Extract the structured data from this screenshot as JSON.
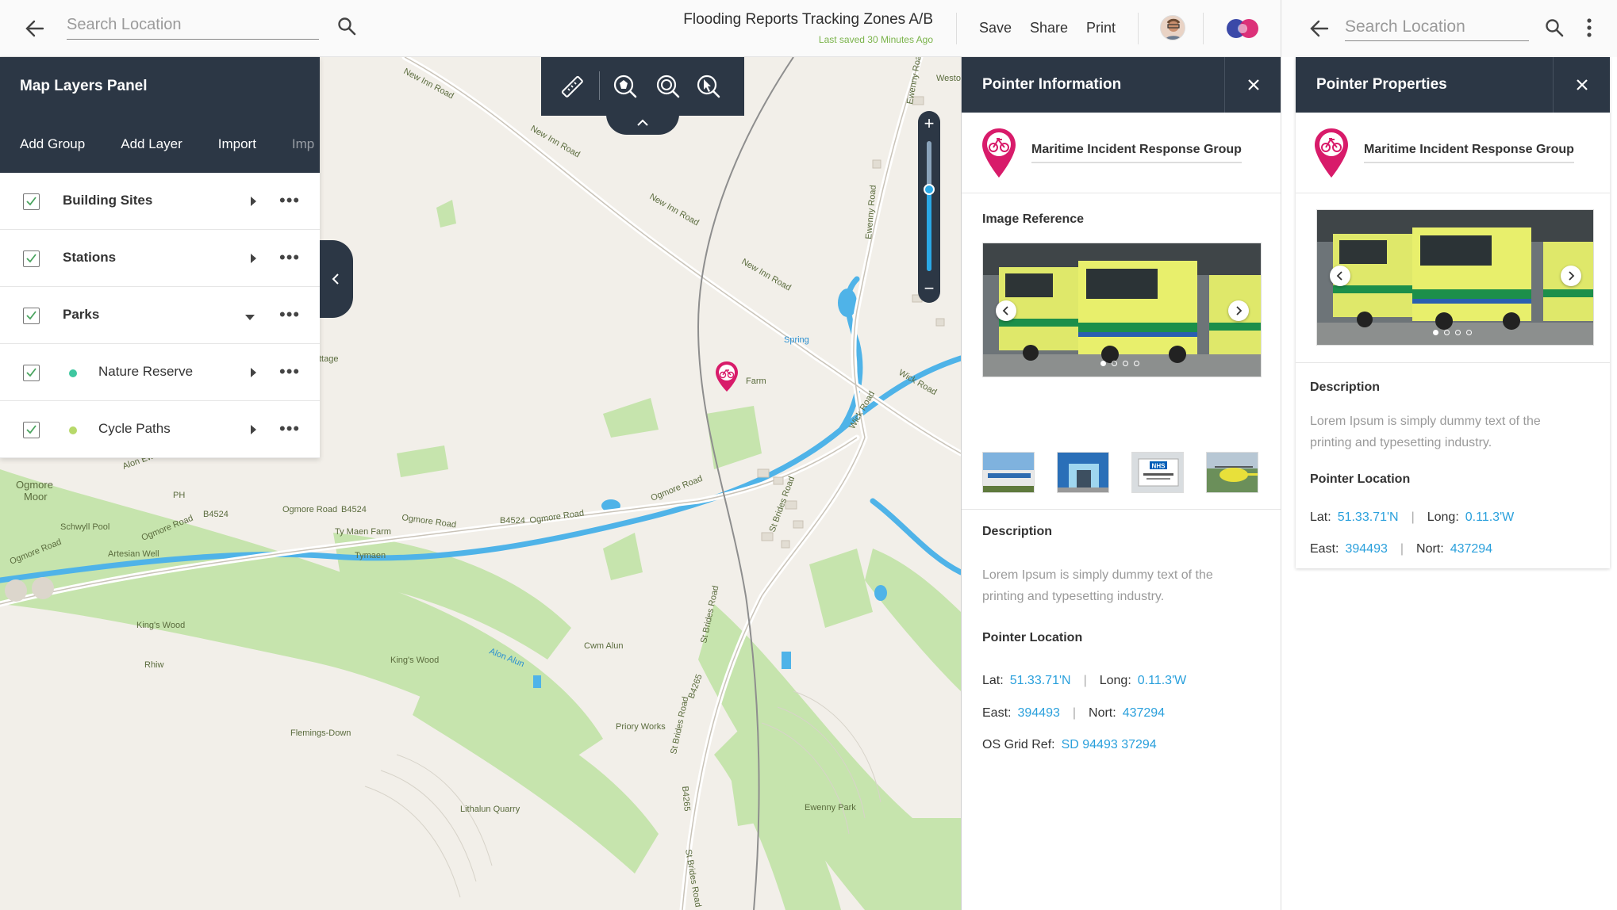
{
  "header": {
    "search_placeholder": "Search Location",
    "title": "Flooding Reports Tracking Zones A/B",
    "last_saved": "Last saved 30 Minutes Ago",
    "actions": [
      "Save",
      "Share",
      "Print"
    ]
  },
  "layers_panel": {
    "title": "Map Layers Panel",
    "toolbar": [
      "Add Group",
      "Add Layer",
      "Import",
      "Imp"
    ],
    "rows": [
      {
        "label": "Building Sites",
        "checked": true,
        "expanded": false
      },
      {
        "label": "Stations",
        "checked": true,
        "expanded": false
      },
      {
        "label": "Parks",
        "checked": true,
        "expanded": true
      },
      {
        "label": "Nature Reserve",
        "checked": true,
        "dot_color": "#3fc7a0"
      },
      {
        "label": "Cycle Paths",
        "checked": true,
        "dot_color": "#b7d96a"
      }
    ]
  },
  "map_tools": [
    "ruler-icon",
    "polygon-select-icon",
    "radius-select-icon",
    "pointer-select-icon"
  ],
  "zoom": {
    "plus": "+",
    "minus": "−",
    "level": 0.62
  },
  "map_labels": {
    "new_inn_road": "New Inn Road",
    "wick_road": "Wick Road",
    "ogmore_road": "Ogmore Road",
    "b4524": "B4524",
    "ogmore_moor": "Ogmore Moor",
    "ph": "PH",
    "schwyll_pool": "Schwyll Pool",
    "artesian_well": "Artesian Well",
    "ty_maen_farm": "Ty Maen Farm",
    "tymaen": "Tymaen",
    "kings_wood": "King's Wood",
    "rhiw": "Rhiw",
    "alon_alun": "Alon Alun",
    "cwm_alun": "Cwm Alun",
    "flemings_down": "Flemings-Down",
    "priory_works": "Priory Works",
    "lithalun_quarry": "Lithalun Quarry",
    "ewenny_park": "Ewenny Park",
    "st_brides_road": "St Brides Road",
    "b4265": "B4265",
    "spring": "Spring",
    "farm": "Farm",
    "ewenny_road": "Ewenny Road",
    "alon_ewenny": "Alon Ewenny",
    "westo": "Westo",
    "ttage": "ttage"
  },
  "pointer_info": {
    "title": "Pointer Information",
    "group_name": "Maritime Incident Response Group",
    "image_reference_label": "Image Reference",
    "image_count": 4,
    "image_active": 1,
    "description_label": "Description",
    "description": "Lorem Ipsum is simply dummy text of the printing and typesetting industry.",
    "location_label": "Pointer Location",
    "lat_label": "Lat:",
    "lat": "51.33.71'N",
    "long_label": "Long:",
    "long": "0.11.3'W",
    "east_label": "East:",
    "east": "394493",
    "nort_label": "Nort:",
    "nort": "437294",
    "grid_label": "OS Grid Ref:",
    "grid": "SD 94493 37294",
    "thumb_nhs": "NHS"
  },
  "pointer_props": {
    "search_placeholder": "Search Location",
    "title": "Pointer Properties",
    "group_name": "Maritime Incident Response Group",
    "description_label": "Description",
    "description": "Lorem Ipsum is simply dummy text of the printing and typesetting industry.",
    "location_label": "Pointer Location",
    "lat_label": "Lat:",
    "lat": "51.33.71'N",
    "long_label": "Long:",
    "long": "0.11.3'W",
    "east_label": "East:",
    "east": "394493",
    "nort_label": "Nort:",
    "nort": "437294"
  },
  "colors": {
    "panel_dark": "#2c3745",
    "accent_blue": "#2aa0dc",
    "pin_magenta": "#d81b6a",
    "saved_green": "#7ab34a",
    "map_bg": "#f2efe9",
    "map_green": "#bfe0a6",
    "water": "#4fb3e8"
  }
}
